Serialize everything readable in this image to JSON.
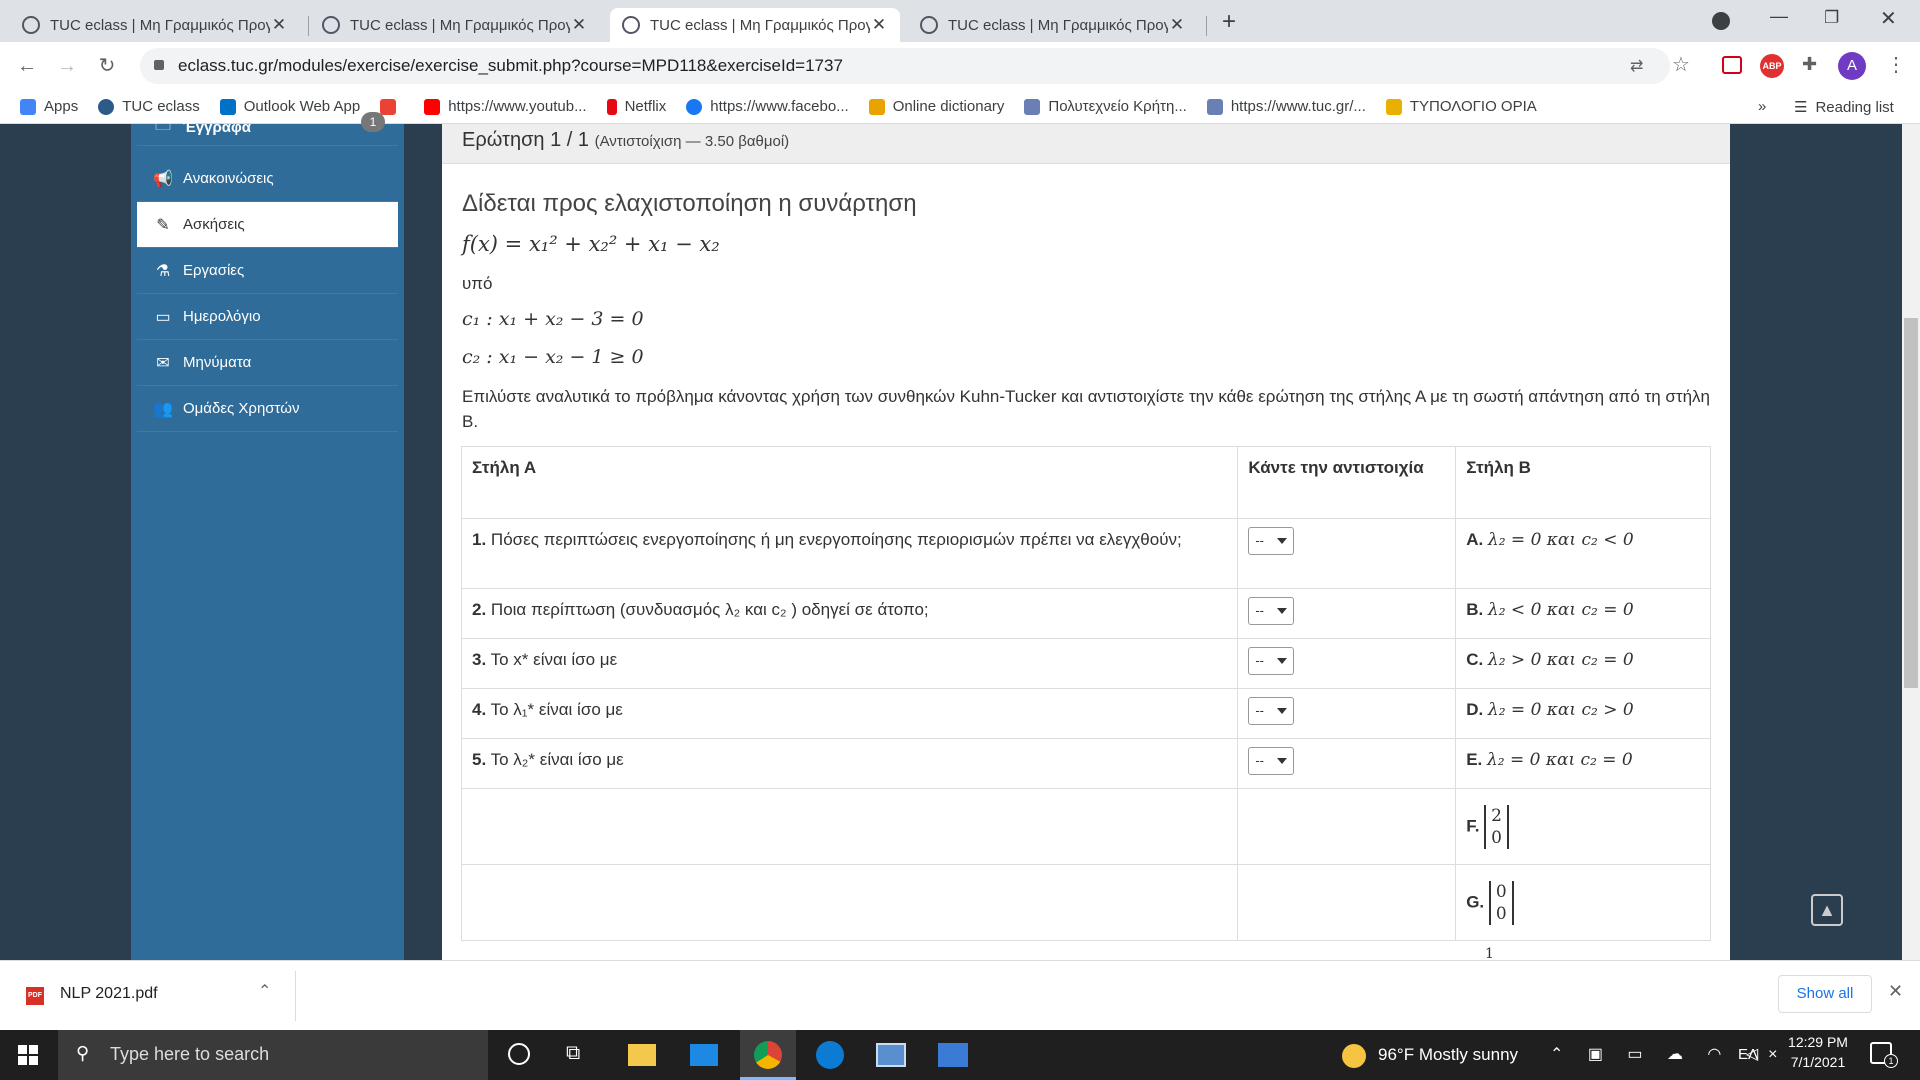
{
  "browser": {
    "tabs": [
      {
        "title": "TUC eclass | Μη Γραμμικός Προγ"
      },
      {
        "title": "TUC eclass | Μη Γραμμικός Προγ"
      },
      {
        "title": "TUC eclass | Μη Γραμμικός Προγ"
      },
      {
        "title": "TUC eclass | Μη Γραμμικός Προγ"
      }
    ],
    "url": "eclass.tuc.gr/modules/exercise/exercise_submit.php?course=MPD118&exerciseId=1737",
    "profile_letter": "A",
    "bookmarks": [
      {
        "label": "Apps",
        "color": "#4285f4"
      },
      {
        "label": "TUC eclass",
        "color": "#2c5b8a"
      },
      {
        "label": "Outlook Web App",
        "color": "#0072c6"
      },
      {
        "label": "",
        "color": "#ea4335"
      },
      {
        "label": "https://www.youtub...",
        "color": "#ff0000"
      },
      {
        "label": "Netflix",
        "color": "#e50914"
      },
      {
        "label": "https://www.facebo...",
        "color": "#1877f2"
      },
      {
        "label": "Online dictionary",
        "color": "#e8a300"
      },
      {
        "label": "Πολυτεχνείο Κρήτη...",
        "color": "#6a7fb5"
      },
      {
        "label": "https://www.tuc.gr/...",
        "color": "#6a7fb5"
      },
      {
        "label": "ΤΥΠΟΛΟΓΙΟ ΟΡΙΑ",
        "color": "#e8b000"
      }
    ],
    "reading_list": "Reading list"
  },
  "sidebar": {
    "items": [
      {
        "label": "Έγγραφα",
        "icon": "folder-icon",
        "badge": "1"
      },
      {
        "label": "Ανακοινώσεις",
        "icon": "bullhorn-icon"
      },
      {
        "label": "Ασκήσεις",
        "icon": "edit-icon",
        "selected": true
      },
      {
        "label": "Εργασίες",
        "icon": "flask-icon"
      },
      {
        "label": "Ημερολόγιο",
        "icon": "calendar-icon"
      },
      {
        "label": "Μηνύματα",
        "icon": "envelope-icon"
      },
      {
        "label": "Ομάδες Χρηστών",
        "icon": "users-icon"
      }
    ]
  },
  "question": {
    "header": "Ερώτηση 1 / 1",
    "header_meta": "(Αντιστοίχιση — 3.50 βαθμοί)",
    "title": "Δίδεται προς ελαχιστοποίηση η συνάρτηση",
    "function": "f(x) = x₁² + x₂² + x₁ − x₂",
    "subject_to": "υπό",
    "c1": "c₁ : x₁ + x₂ − 3 = 0",
    "c2": "c₂ : x₁ − x₂ − 1 ≥ 0",
    "instructions": "Επιλύστε αναλυτικά το πρόβλημα κάνοντας χρήση των συνθηκών Kuhn-Tucker και αντιστοιχίστε την κάθε ερώτηση της στήλης Α με τη σωστή απάντηση από τη στήλη Β."
  },
  "table": {
    "col_a": "Στήλη Α",
    "col_mid": "Κάντε την αντιστοιχία",
    "col_b": "Στήλη Β",
    "select_placeholder": "--",
    "rows": [
      {
        "num": "1.",
        "a": "Πόσες περιπτώσεις ενεργοποίησης ή μη ενεργοποίησης περιορισμών πρέπει να ελεγχθούν;",
        "blet": "A.",
        "b": "λ₂ = 0 και c₂ < 0"
      },
      {
        "num": "2.",
        "a": "Ποια περίπτωση (συνδυασμός λ₂ και c₂ ) οδηγεί σε άτοπο;",
        "blet": "B.",
        "b": "λ₂ < 0 και c₂ = 0"
      },
      {
        "num": "3.",
        "a": "Το x* είναι ίσο με",
        "blet": "C.",
        "b": "λ₂ > 0 και c₂ = 0"
      },
      {
        "num": "4.",
        "a": "Το λ₁* είναι ίσο με",
        "blet": "D.",
        "b": "λ₂ = 0 και c₂ > 0"
      },
      {
        "num": "5.",
        "a": "Το λ₂* είναι ίσο με",
        "blet": "E.",
        "b": "λ₂ = 0 και c₂ = 0"
      }
    ],
    "vectors": [
      {
        "blet": "F.",
        "top": "2",
        "bottom": "0"
      },
      {
        "blet": "G.",
        "top": "0",
        "bottom": "0"
      }
    ],
    "partial_next": "1"
  },
  "downloads": {
    "file": "NLP 2021.pdf",
    "show_all": "Show all"
  },
  "taskbar": {
    "search_placeholder": "Type here to search",
    "weather": "96°F  Mostly sunny",
    "lang": "ΕΛ",
    "time": "12:29 PM",
    "date": "7/1/2021",
    "notif_count": "1"
  }
}
